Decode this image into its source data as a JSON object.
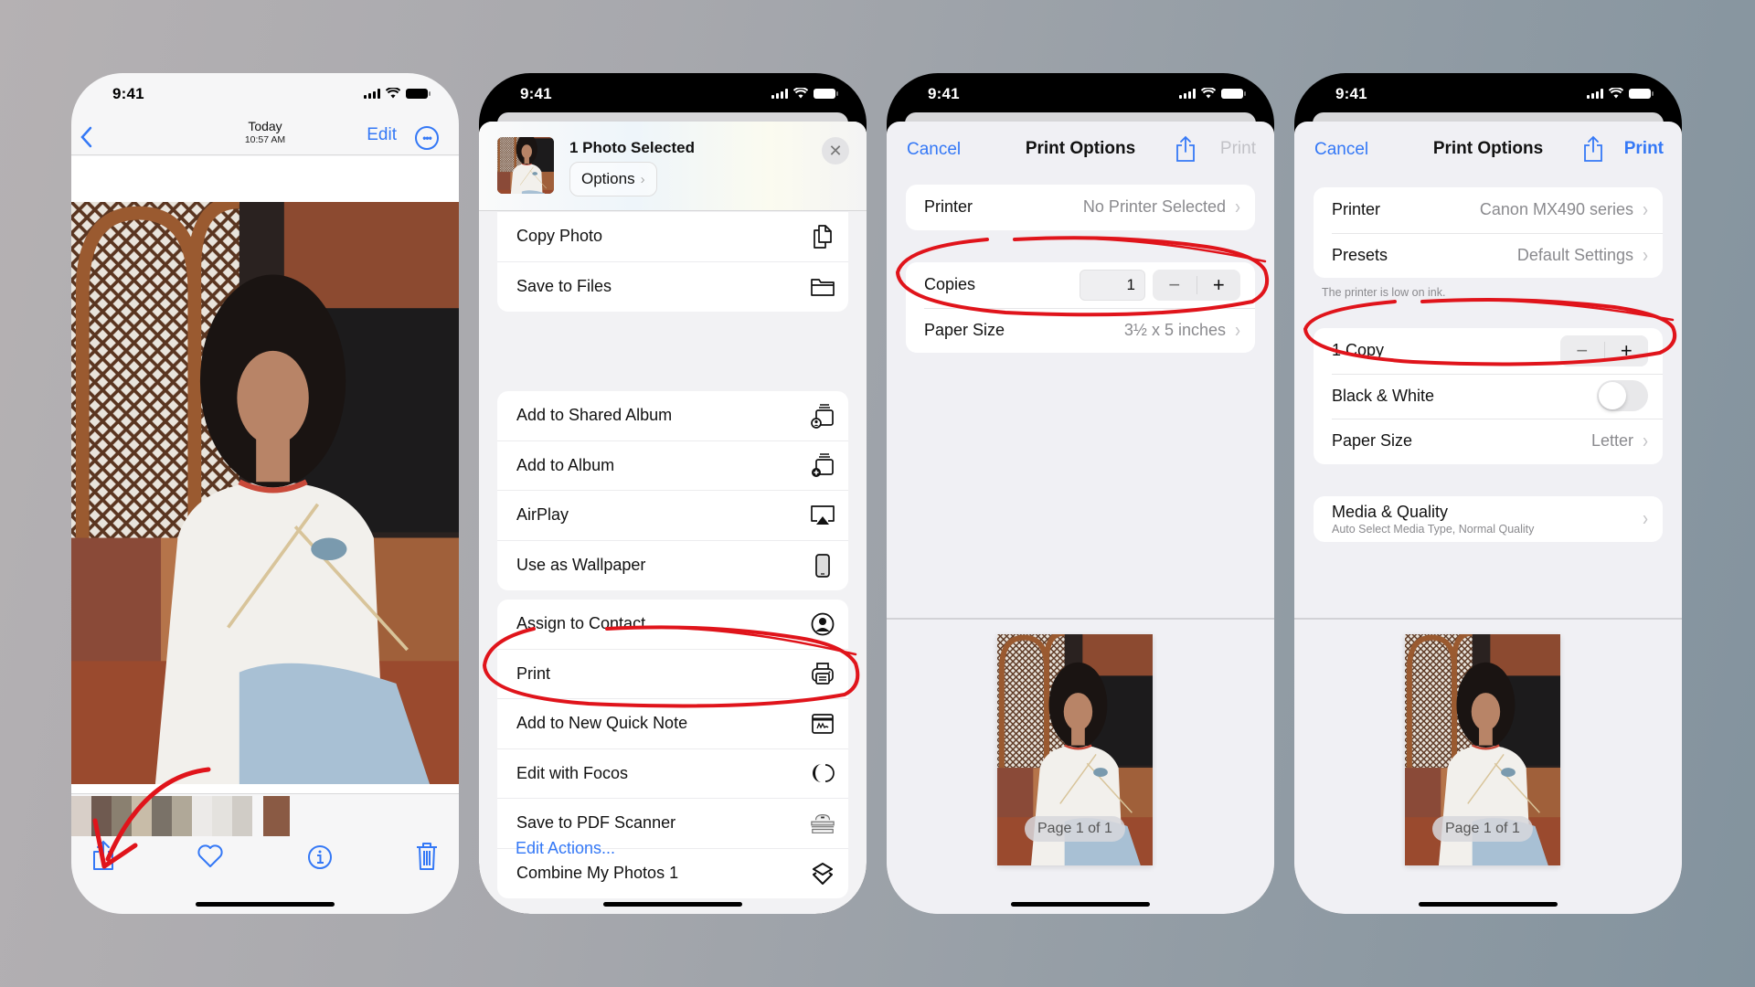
{
  "status_bar": {
    "time": "9:41"
  },
  "colors": {
    "accent": "#3478f6",
    "annotation": "#e0141b",
    "background_start": "#b5b1b3",
    "background_end": "#83939e"
  },
  "phone1": {
    "nav": {
      "back_icon": "chevron-left-icon",
      "title": "Today",
      "subtitle": "10:57 AM",
      "edit_label": "Edit",
      "more_icon": "ellipsis-circle-icon"
    },
    "toolbar": [
      {
        "name": "share",
        "icon": "share-icon"
      },
      {
        "name": "favorite",
        "icon": "heart-icon"
      },
      {
        "name": "info",
        "icon": "info-icon"
      },
      {
        "name": "delete",
        "icon": "trash-icon"
      }
    ],
    "annotation": "arrow pointing to share button"
  },
  "phone2": {
    "header": {
      "title": "1 Photo Selected",
      "options_label": "Options",
      "close_icon": "close-icon"
    },
    "groups": [
      [
        {
          "label": "Copy Photo",
          "icon": "copy-icon"
        },
        {
          "label": "Save to Files",
          "icon": "folder-icon"
        }
      ],
      [
        {
          "label": "Add to Shared Album",
          "icon": "shared-album-icon"
        },
        {
          "label": "Add to Album",
          "icon": "add-album-icon"
        },
        {
          "label": "AirPlay",
          "icon": "airplay-icon"
        },
        {
          "label": "Use as Wallpaper",
          "icon": "phone-icon"
        }
      ],
      [
        {
          "label": "Assign to Contact",
          "icon": "contact-icon"
        },
        {
          "label": "Print",
          "icon": "printer-icon",
          "highlighted": true
        },
        {
          "label": "Add to New Quick Note",
          "icon": "quick-note-icon"
        },
        {
          "label": "Edit with Focos",
          "icon": "focos-icon"
        },
        {
          "label": "Save to PDF Scanner",
          "icon": "scanner-icon"
        },
        {
          "label": "Combine My Photos 1",
          "icon": "shortcuts-icon"
        }
      ]
    ],
    "edit_actions_label": "Edit Actions..."
  },
  "phone3": {
    "nav": {
      "cancel_label": "Cancel",
      "title": "Print Options",
      "print_label": "Print",
      "print_enabled": false
    },
    "printer": {
      "label": "Printer",
      "value": "No Printer Selected",
      "highlighted": true
    },
    "copies": {
      "label": "Copies",
      "value": "1",
      "minus": "−",
      "plus": "+"
    },
    "paper_size": {
      "label": "Paper Size",
      "value": "3½ x 5 inches"
    },
    "preview": {
      "page_label": "Page 1 of 1"
    }
  },
  "phone4": {
    "nav": {
      "cancel_label": "Cancel",
      "title": "Print Options",
      "print_label": "Print",
      "print_enabled": true
    },
    "printer": {
      "label": "Printer",
      "value": "Canon MX490 series"
    },
    "presets": {
      "label": "Presets",
      "value": "Default Settings",
      "highlighted": true
    },
    "ink_warning": "The printer is low on ink.",
    "copies": {
      "label": "1 Copy",
      "minus": "−",
      "plus": "+"
    },
    "black_white": {
      "label": "Black & White",
      "enabled": false
    },
    "paper_size": {
      "label": "Paper Size",
      "value": "Letter"
    },
    "media_quality": {
      "label": "Media & Quality",
      "sublabel": "Auto Select Media Type, Normal Quality"
    },
    "preview": {
      "page_label": "Page 1 of 1"
    }
  }
}
